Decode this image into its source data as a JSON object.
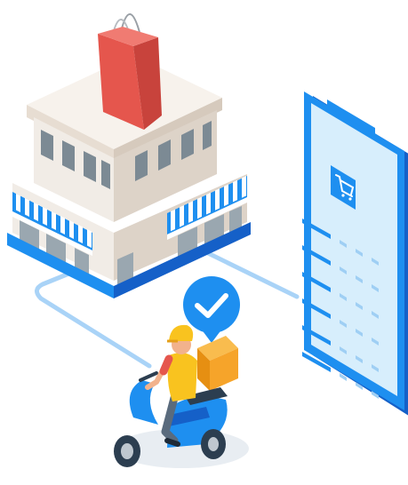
{
  "scene": {
    "icons": {
      "store": "store-building-icon",
      "bag": "shopping-bag-icon",
      "phone": "smartphone-icon",
      "cart": "shopping-cart-icon",
      "check": "checkmark-pin-icon",
      "courier": "delivery-scooter-icon"
    },
    "colors": {
      "primary_blue": "#1e8ff0",
      "light_blue": "#cde9fb",
      "route_line": "#a9d3f7",
      "bag_red": "#e5564d",
      "box_orange": "#f6a42a",
      "building_wall": "#f1ece6",
      "window": "#7c8a94"
    },
    "phone_rows": 6
  }
}
